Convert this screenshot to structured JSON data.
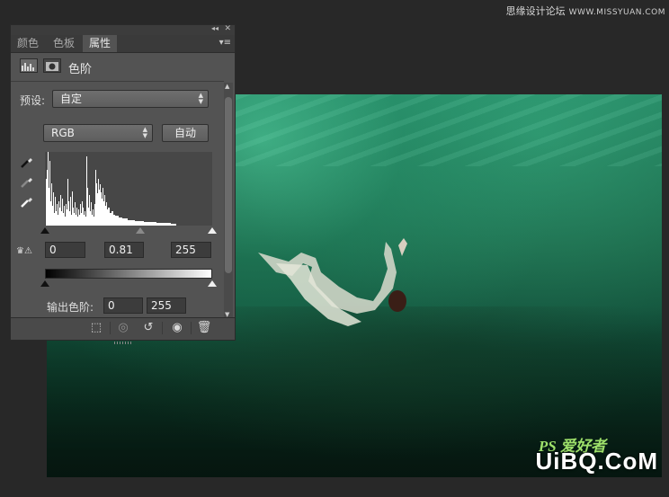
{
  "watermark": {
    "site_text": "思缘设计论坛",
    "site_url": "WWW.MISSYUAN.COM"
  },
  "photo_logo": {
    "ps_mark": "PS 爱好者",
    "uibq": "UiBQ.CoM"
  },
  "panel": {
    "tabs": [
      {
        "label": "颜色",
        "active": false
      },
      {
        "label": "色板",
        "active": false
      },
      {
        "label": "属性",
        "active": true
      }
    ],
    "adjustment_title": "色阶",
    "preset": {
      "label": "预设:",
      "value": "自定"
    },
    "channel": {
      "value": "RGB"
    },
    "auto_button": "自动",
    "input_levels": {
      "black": "0",
      "gamma": "0.81",
      "white": "255"
    },
    "output_levels": {
      "label": "输出色阶:",
      "black": "0",
      "white": "255"
    },
    "icons": {
      "black_point": "eyedropper-black-icon",
      "gray_point": "eyedropper-gray-icon",
      "white_point": "eyedropper-white-icon",
      "clipping_warning": "clipping-warning-icon"
    },
    "footer_icons": [
      "clip-to-layer-icon",
      "view-previous-icon",
      "reset-icon",
      "visibility-eye-icon",
      "trash-icon"
    ]
  }
}
